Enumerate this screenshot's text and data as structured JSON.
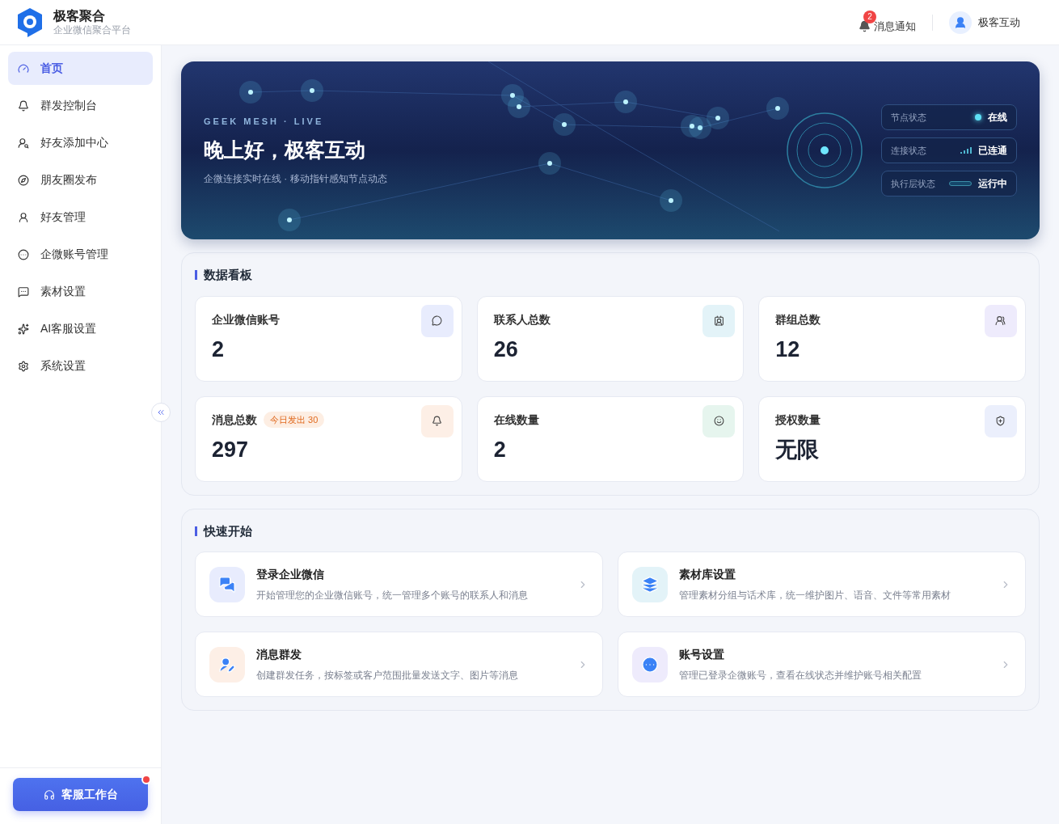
{
  "brand": {
    "name": "极客聚合",
    "subtitle": "企业微信聚合平台"
  },
  "header": {
    "notifications": {
      "label": "消息通知",
      "count": "2"
    },
    "user": {
      "name": "极客互动"
    }
  },
  "sidebar": {
    "items": [
      {
        "label": "首页",
        "selected": true
      },
      {
        "label": "群发控制台",
        "selected": false
      },
      {
        "label": "好友添加中心",
        "selected": false
      },
      {
        "label": "朋友圈发布",
        "selected": false
      },
      {
        "label": "好友管理",
        "selected": false
      },
      {
        "label": "企微账号管理",
        "selected": false
      },
      {
        "label": "素材设置",
        "selected": false
      },
      {
        "label": "AI客服设置",
        "selected": false
      },
      {
        "label": "系统设置",
        "selected": false
      }
    ],
    "workbench_button": {
      "label": "客服工作台",
      "alert": true
    }
  },
  "banner": {
    "eyebrow": "GEEK MESH · LIVE",
    "greeting": "晚上好，极客互动",
    "subtitle": "企微连接实时在线 · 移动指针感知节点动态",
    "statuses": [
      {
        "kind": "dot",
        "label": "节点状态",
        "value": "在线"
      },
      {
        "kind": "bars",
        "label": "连接状态",
        "value": "已连通"
      },
      {
        "kind": "pill",
        "label": "执行层状态",
        "value": "运行中"
      }
    ]
  },
  "dashboard": {
    "title": "数据看板",
    "cards": [
      {
        "label": "企业微信账号",
        "value": "2",
        "color": "#e8ecfd"
      },
      {
        "label": "联系人总数",
        "value": "26",
        "color": "#e3f3f8"
      },
      {
        "label": "群组总数",
        "value": "12",
        "color": "#eeebfc"
      },
      {
        "label": "消息总数",
        "badge": "今日发出 30",
        "value": "297",
        "color": "#fdefe6"
      },
      {
        "label": "在线数量",
        "value": "2",
        "color": "#e6f5ee"
      },
      {
        "label": "授权数量",
        "value": "无限",
        "color": "#ebeffc"
      }
    ]
  },
  "quick_start": {
    "title": "快速开始",
    "items": [
      {
        "title": "登录企业微信",
        "description": "开始管理您的企业微信账号，统一管理多个账号的联系人和消息",
        "color": "#e8ecfd"
      },
      {
        "title": "素材库设置",
        "description": "管理素材分组与话术库，统一维护图片、语音、文件等常用素材",
        "color": "#e3f3f8"
      },
      {
        "title": "消息群发",
        "description": "创建群发任务，按标签或客户范围批量发送文字、图片等消息",
        "color": "#fdefe6"
      },
      {
        "title": "账号设置",
        "description": "管理已登录企微账号，查看在线状态并维护账号相关配置",
        "color": "#eeebfc"
      }
    ]
  }
}
